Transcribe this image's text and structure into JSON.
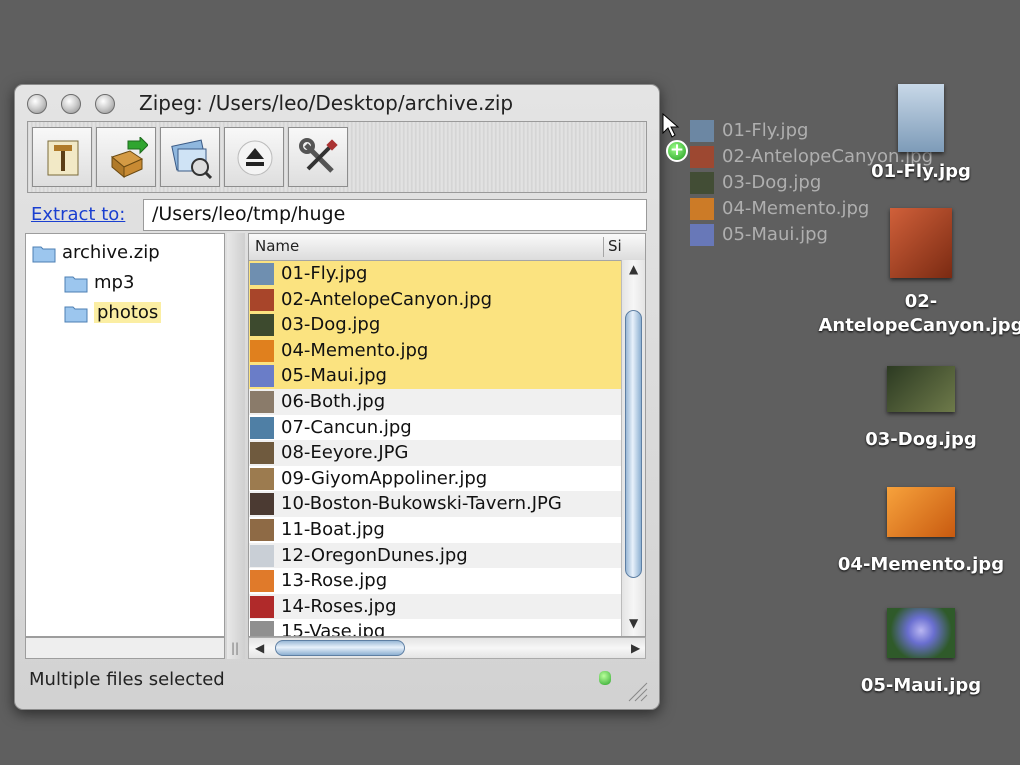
{
  "window": {
    "title": "Zipeg: /Users/leo/Desktop/archive.zip",
    "extract_link": "Extract to:",
    "extract_path": "/Users/leo/tmp/huge",
    "status": "Multiple files selected"
  },
  "toolbar": {
    "buttons": [
      "extract",
      "up-to-parent",
      "preview",
      "eject",
      "preferences"
    ]
  },
  "tree": {
    "root": "archive.zip",
    "children": [
      "mp3",
      "photos"
    ],
    "selected": "photos"
  },
  "list": {
    "col_name": "Name",
    "col_size": "Si",
    "rows": [
      {
        "name": "01-Fly.jpg",
        "selected": true,
        "thumb": "#6f8fb0"
      },
      {
        "name": "02-AntelopeCanyon.jpg",
        "selected": true,
        "thumb": "#a8452a"
      },
      {
        "name": "03-Dog.jpg",
        "selected": true,
        "thumb": "#3d4a2e"
      },
      {
        "name": "04-Memento.jpg",
        "selected": true,
        "thumb": "#e0801e"
      },
      {
        "name": "05-Maui.jpg",
        "selected": true,
        "thumb": "#6a7dc8"
      },
      {
        "name": "06-Both.jpg",
        "selected": false,
        "thumb": "#8a7b6a"
      },
      {
        "name": "07-Cancun.jpg",
        "selected": false,
        "thumb": "#4f7fa5"
      },
      {
        "name": "08-Eeyore.JPG",
        "selected": false,
        "thumb": "#6f5a3e"
      },
      {
        "name": "09-GiyomAppoliner.jpg",
        "selected": false,
        "thumb": "#9c7b4f"
      },
      {
        "name": "10-Boston-Bukowski-Tavern.JPG",
        "selected": false,
        "thumb": "#4b3a32"
      },
      {
        "name": "11-Boat.jpg",
        "selected": false,
        "thumb": "#8e6a45"
      },
      {
        "name": "12-OregonDunes.jpg",
        "selected": false,
        "thumb": "#c9cfd6"
      },
      {
        "name": "13-Rose.jpg",
        "selected": false,
        "thumb": "#e07a2a"
      },
      {
        "name": "14-Roses.jpg",
        "selected": false,
        "thumb": "#b02a2a"
      },
      {
        "name": "15-Vase.jpg",
        "selected": false,
        "thumb": "#8f8f8f"
      }
    ]
  },
  "drag": {
    "items": [
      {
        "name": "01-Fly.jpg",
        "thumb": "#6f8fb0"
      },
      {
        "name": "02-AntelopeCanyon.jpg",
        "thumb": "#a8452a"
      },
      {
        "name": "03-Dog.jpg",
        "thumb": "#3d4a2e"
      },
      {
        "name": "04-Memento.jpg",
        "thumb": "#e0801e"
      },
      {
        "name": "05-Maui.jpg",
        "thumb": "#6a7dc8"
      }
    ]
  },
  "desktop": {
    "icons": [
      {
        "label": "01-Fly.jpg"
      },
      {
        "label": "02-AntelopeCanyon.jpg",
        "label_line1": "02-",
        "label_line2": "AntelopeCanyon.jpg"
      },
      {
        "label": "03-Dog.jpg"
      },
      {
        "label": "04-Memento.jpg"
      },
      {
        "label": "05-Maui.jpg"
      }
    ]
  }
}
